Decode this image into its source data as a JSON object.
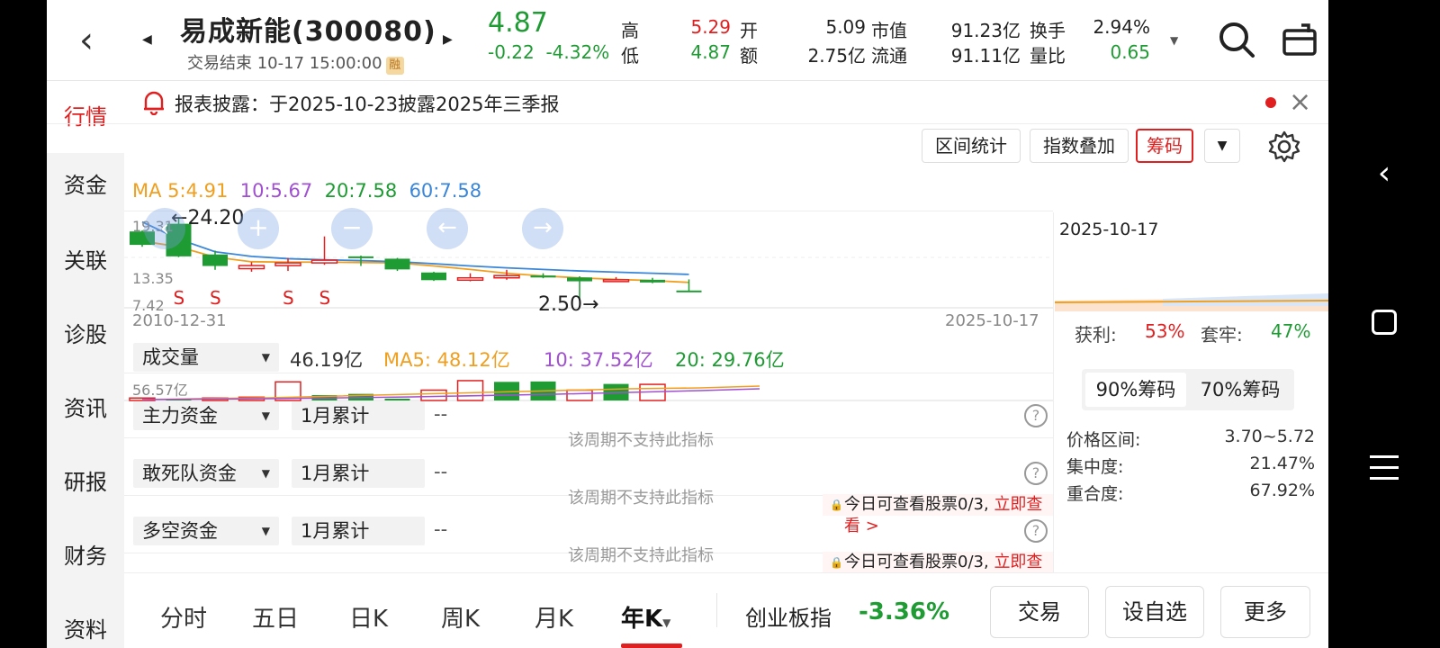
{
  "header": {
    "title": "易成新能(300080)",
    "status": "交易结束 10-17 15:00:00",
    "rong_badge": "融",
    "price": "4.87",
    "change": "-0.22",
    "change_pct": "-4.32%",
    "stats": {
      "high_label": "高",
      "high": "5.29",
      "low_label": "低",
      "low": "4.87",
      "open_label": "开",
      "open": "5.09",
      "amount_label": "额",
      "amount": "2.75亿",
      "mktcap_label": "市值",
      "mktcap": "91.23亿",
      "float_label": "流通",
      "float": "91.11亿",
      "turnover_label": "换手",
      "turnover": "2.94%",
      "volratio_label": "量比",
      "volratio": "0.65"
    }
  },
  "notice": {
    "text": "报表披露：于2025-10-23披露2025年三季报"
  },
  "sidebar": {
    "items": [
      "行情",
      "资金",
      "关联",
      "诊股",
      "资讯",
      "研报",
      "财务",
      "资料"
    ]
  },
  "toolbar": {
    "range_stats": "区间统计",
    "index_overlay": "指数叠加",
    "chips": "筹码"
  },
  "ma": {
    "ma5": "MA 5:4.91",
    "ma10": "10:5.67",
    "ma20": "20:7.58",
    "ma60": "60:7.58"
  },
  "kline": {
    "high_label": "24.20",
    "low_label": "2.50",
    "axis_labels": [
      "19.31",
      "13.35",
      "7.42"
    ],
    "start_date": "2010-12-31",
    "end_date": "2025-10-17",
    "s_mark": "S",
    "candles": [
      {
        "o": 20.5,
        "c": 17.0,
        "h": 20.8,
        "l": 16.5
      },
      {
        "o": 22.5,
        "c": 14.0,
        "h": 24.2,
        "l": 13.8
      },
      {
        "o": 14.5,
        "c": 11.5,
        "h": 15.5,
        "l": 10.5
      },
      {
        "o": 10.8,
        "c": 11.6,
        "h": 12.5,
        "l": 10.0
      },
      {
        "o": 11.6,
        "c": 12.3,
        "h": 13.6,
        "l": 10.2
      },
      {
        "o": 12.3,
        "c": 13.0,
        "h": 19.2,
        "l": 11.8
      },
      {
        "o": 14.0,
        "c": 13.6,
        "h": 14.2,
        "l": 11.5
      },
      {
        "o": 13.4,
        "c": 10.6,
        "h": 13.6,
        "l": 10.2
      },
      {
        "o": 9.8,
        "c": 7.8,
        "h": 10.0,
        "l": 7.6
      },
      {
        "o": 7.8,
        "c": 8.4,
        "h": 9.6,
        "l": 7.5
      },
      {
        "o": 8.4,
        "c": 9.0,
        "h": 10.5,
        "l": 7.9
      },
      {
        "o": 9.0,
        "c": 8.5,
        "h": 9.6,
        "l": 8.3
      },
      {
        "o": 8.5,
        "c": 7.5,
        "h": 8.8,
        "l": 2.5
      },
      {
        "o": 7.5,
        "c": 7.9,
        "h": 8.6,
        "l": 7.3
      },
      {
        "o": 7.9,
        "c": 7.2,
        "h": 8.4,
        "l": 7.0
      },
      {
        "o": 5.1,
        "c": 4.87,
        "h": 8.0,
        "l": 4.8
      }
    ],
    "ma_series": [
      {
        "name": "ma5",
        "color": "#f0a020",
        "values": [
          18.0,
          16.5,
          13.8,
          12.6,
          12.5,
          12.5,
          12.4,
          12.3,
          11.5,
          10.6,
          9.6,
          8.9,
          8.4,
          8.0,
          7.7,
          7.2
        ]
      },
      {
        "name": "ma60",
        "color": "#3a86d8",
        "values": [
          23.0,
          18.5,
          15.2,
          14.0,
          13.4,
          13.1,
          12.9,
          12.6,
          12.1,
          11.5,
          11.0,
          10.6,
          10.2,
          9.9,
          9.6,
          9.3
        ]
      }
    ]
  },
  "volume": {
    "selector": "成交量",
    "value": "46.19亿",
    "ma5": "MA5: 48.12亿",
    "ma10": "10: 37.52亿",
    "ma20": "20: 29.76亿",
    "axis_top": "56.57亿",
    "bars": [
      {
        "v": 6,
        "up": true
      },
      {
        "v": 2,
        "up": false
      },
      {
        "v": 6,
        "up": true
      },
      {
        "v": 8,
        "up": true
      },
      {
        "v": 45,
        "up": true
      },
      {
        "v": 13,
        "up": false
      },
      {
        "v": 16,
        "up": false
      },
      {
        "v": 4,
        "up": false
      },
      {
        "v": 25,
        "up": true
      },
      {
        "v": 48,
        "up": true
      },
      {
        "v": 45,
        "up": false
      },
      {
        "v": 46,
        "up": false
      },
      {
        "v": 25,
        "up": true
      },
      {
        "v": 40,
        "up": false
      },
      {
        "v": 39,
        "up": true
      }
    ]
  },
  "indicators": [
    {
      "selector": "主力资金",
      "period": "1月累计",
      "value": "--",
      "notice": "该周期不支持此指标",
      "promo": null
    },
    {
      "selector": "敢死队资金",
      "period": "1月累计",
      "value": "--",
      "notice": "该周期不支持此指标",
      "promo": {
        "text": "今日可查看股票0/3,",
        "link": "立即查看 >"
      }
    },
    {
      "selector": "多空资金",
      "period": "1月累计",
      "value": "--",
      "notice": "该周期不支持此指标",
      "promo": {
        "text": "今日可查看股票0/3,",
        "link": "立即查看 >"
      }
    }
  ],
  "chips_panel": {
    "date": "2025-10-17",
    "profit_label": "获利:",
    "profit": "53%",
    "trapped_label": "套牢:",
    "trapped": "47%",
    "tab_90": "90%筹码",
    "tab_70": "70%筹码",
    "range_label": "价格区间:",
    "range": "3.70~5.72",
    "conc_label": "集中度:",
    "conc": "21.47%",
    "overlap_label": "重合度:",
    "overlap": "67.92%"
  },
  "period_tabs": [
    "分时",
    "五日",
    "日K",
    "周K",
    "月K",
    "年K"
  ],
  "bottom": {
    "index_name": "创业板指",
    "index_change": "-3.36%",
    "trade": "交易",
    "watchlist": "设自选",
    "more": "更多"
  },
  "colors": {
    "up": "#e02020",
    "down": "#1e9b33",
    "ma5": "#f0a020",
    "ma10": "#a050d0",
    "ma20": "#1e9b33",
    "ma60": "#3a86d8"
  }
}
